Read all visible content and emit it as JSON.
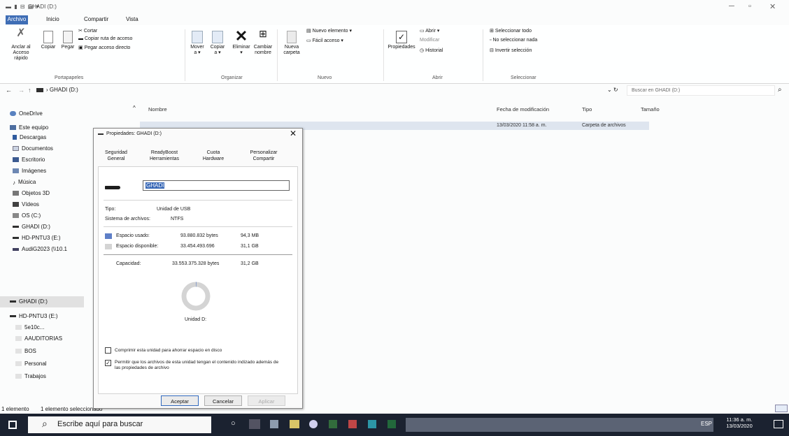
{
  "window": {
    "quick_access": "▬ ▮ ⊟ ▤ ▾",
    "title": "GHADI (D:)"
  },
  "menu": {
    "tabs": [
      "Archivo",
      "Inicio",
      "Compartir",
      "Vista"
    ]
  },
  "ribbon": {
    "pin_label": "Anclar al Acceso rápido",
    "copy_label": "Copiar",
    "paste_label": "Pegar",
    "cut": "Cortar",
    "copy_path": "Copiar ruta de acceso",
    "paste_shortcut": "Pegar acceso directo",
    "clipboard_group": "Portapapeles",
    "move_label": "Mover a ▾",
    "copyto_label": "Copiar a ▾",
    "delete_label": "Eliminar ▾",
    "rename_label": "Cambiar nombre",
    "organize_group": "Organizar",
    "newfolder_label": "Nueva carpeta",
    "new_item": "Nuevo elemento ▾",
    "easy_access": "Fácil acceso ▾",
    "new_group": "Nuevo",
    "properties_label": "Propiedades",
    "open": "Abrir ▾",
    "edit": "Modificar",
    "history": "Historial",
    "open_group": "Abrir",
    "select_all": "Seleccionar todo",
    "select_none": "No seleccionar nada",
    "invert": "Invertir selección",
    "select_group": "Seleccionar"
  },
  "address": {
    "path": "›  GHADI (D:)",
    "search_placeholder": "Buscar en GHADI (D:)"
  },
  "nav": {
    "items": [
      "OneDrive",
      "Este equipo",
      "Descargas",
      "Documentos",
      "Escritorio",
      "Imágenes",
      "Música",
      "Objetos 3D",
      "Vídeos",
      "OS (C:)",
      "GHADI (D:)",
      "HD-PNTU3 (E:)",
      "AudiG2023 (\\\\10.1",
      "GHADI (D:)",
      "HD-PNTU3 (E:)",
      "5e10c...",
      "AAUDITORIAS",
      "BOS",
      "Personal",
      "Trabajos"
    ]
  },
  "columns": {
    "name": "Nombre",
    "date": "Fecha de modificación",
    "type": "Tipo",
    "size": "Tamaño"
  },
  "file_row": {
    "date": "13/03/2020 11:58 a. m.",
    "type": "Carpeta de archivos"
  },
  "status": {
    "count": "1 elemento",
    "selected": "1 elemento seleccionado"
  },
  "taskbar": {
    "search_placeholder": "Escribe aquí para buscar",
    "clock_time": "11:36 a. m.",
    "clock_date": "13/03/2020",
    "lang": "ESP"
  },
  "dialog": {
    "title": "Propiedades: GHADI (D:)",
    "close": "✕",
    "tabs_row1": [
      "Seguridad",
      "ReadyBoost",
      "Cuota",
      "Personalizar"
    ],
    "tabs_row2": [
      "General",
      "Herramientas",
      "Hardware",
      "Compartir"
    ],
    "name_value": "GHADI",
    "type_label": "Tipo:",
    "type_value": "Unidad de USB",
    "fs_label": "Sistema de archivos:",
    "fs_value": "NTFS",
    "used_label": "Espacio usado:",
    "used_bytes": "93.880.832 bytes",
    "used_size": "94,3 MB",
    "free_label": "Espacio disponible:",
    "free_bytes": "33.454.493.696",
    "free_size": "31,1 GB",
    "cap_label": "Capacidad:",
    "cap_bytes": "33.553.375.328 bytes",
    "cap_size": "31,2 GB",
    "drive_label": "Unidad D:",
    "compress_text": "Comprimir esta unidad para ahorrar espacio en disco",
    "index_text": "Permitir que los archivos de esta unidad tengan el contenido indizado además de las propiedades de archivo",
    "ok": "Aceptar",
    "cancel": "Cancelar",
    "apply": "Aplicar",
    "used_fraction": 0.003,
    "used_color": "#5a7fd0",
    "free_color": "#d0d0d0"
  }
}
